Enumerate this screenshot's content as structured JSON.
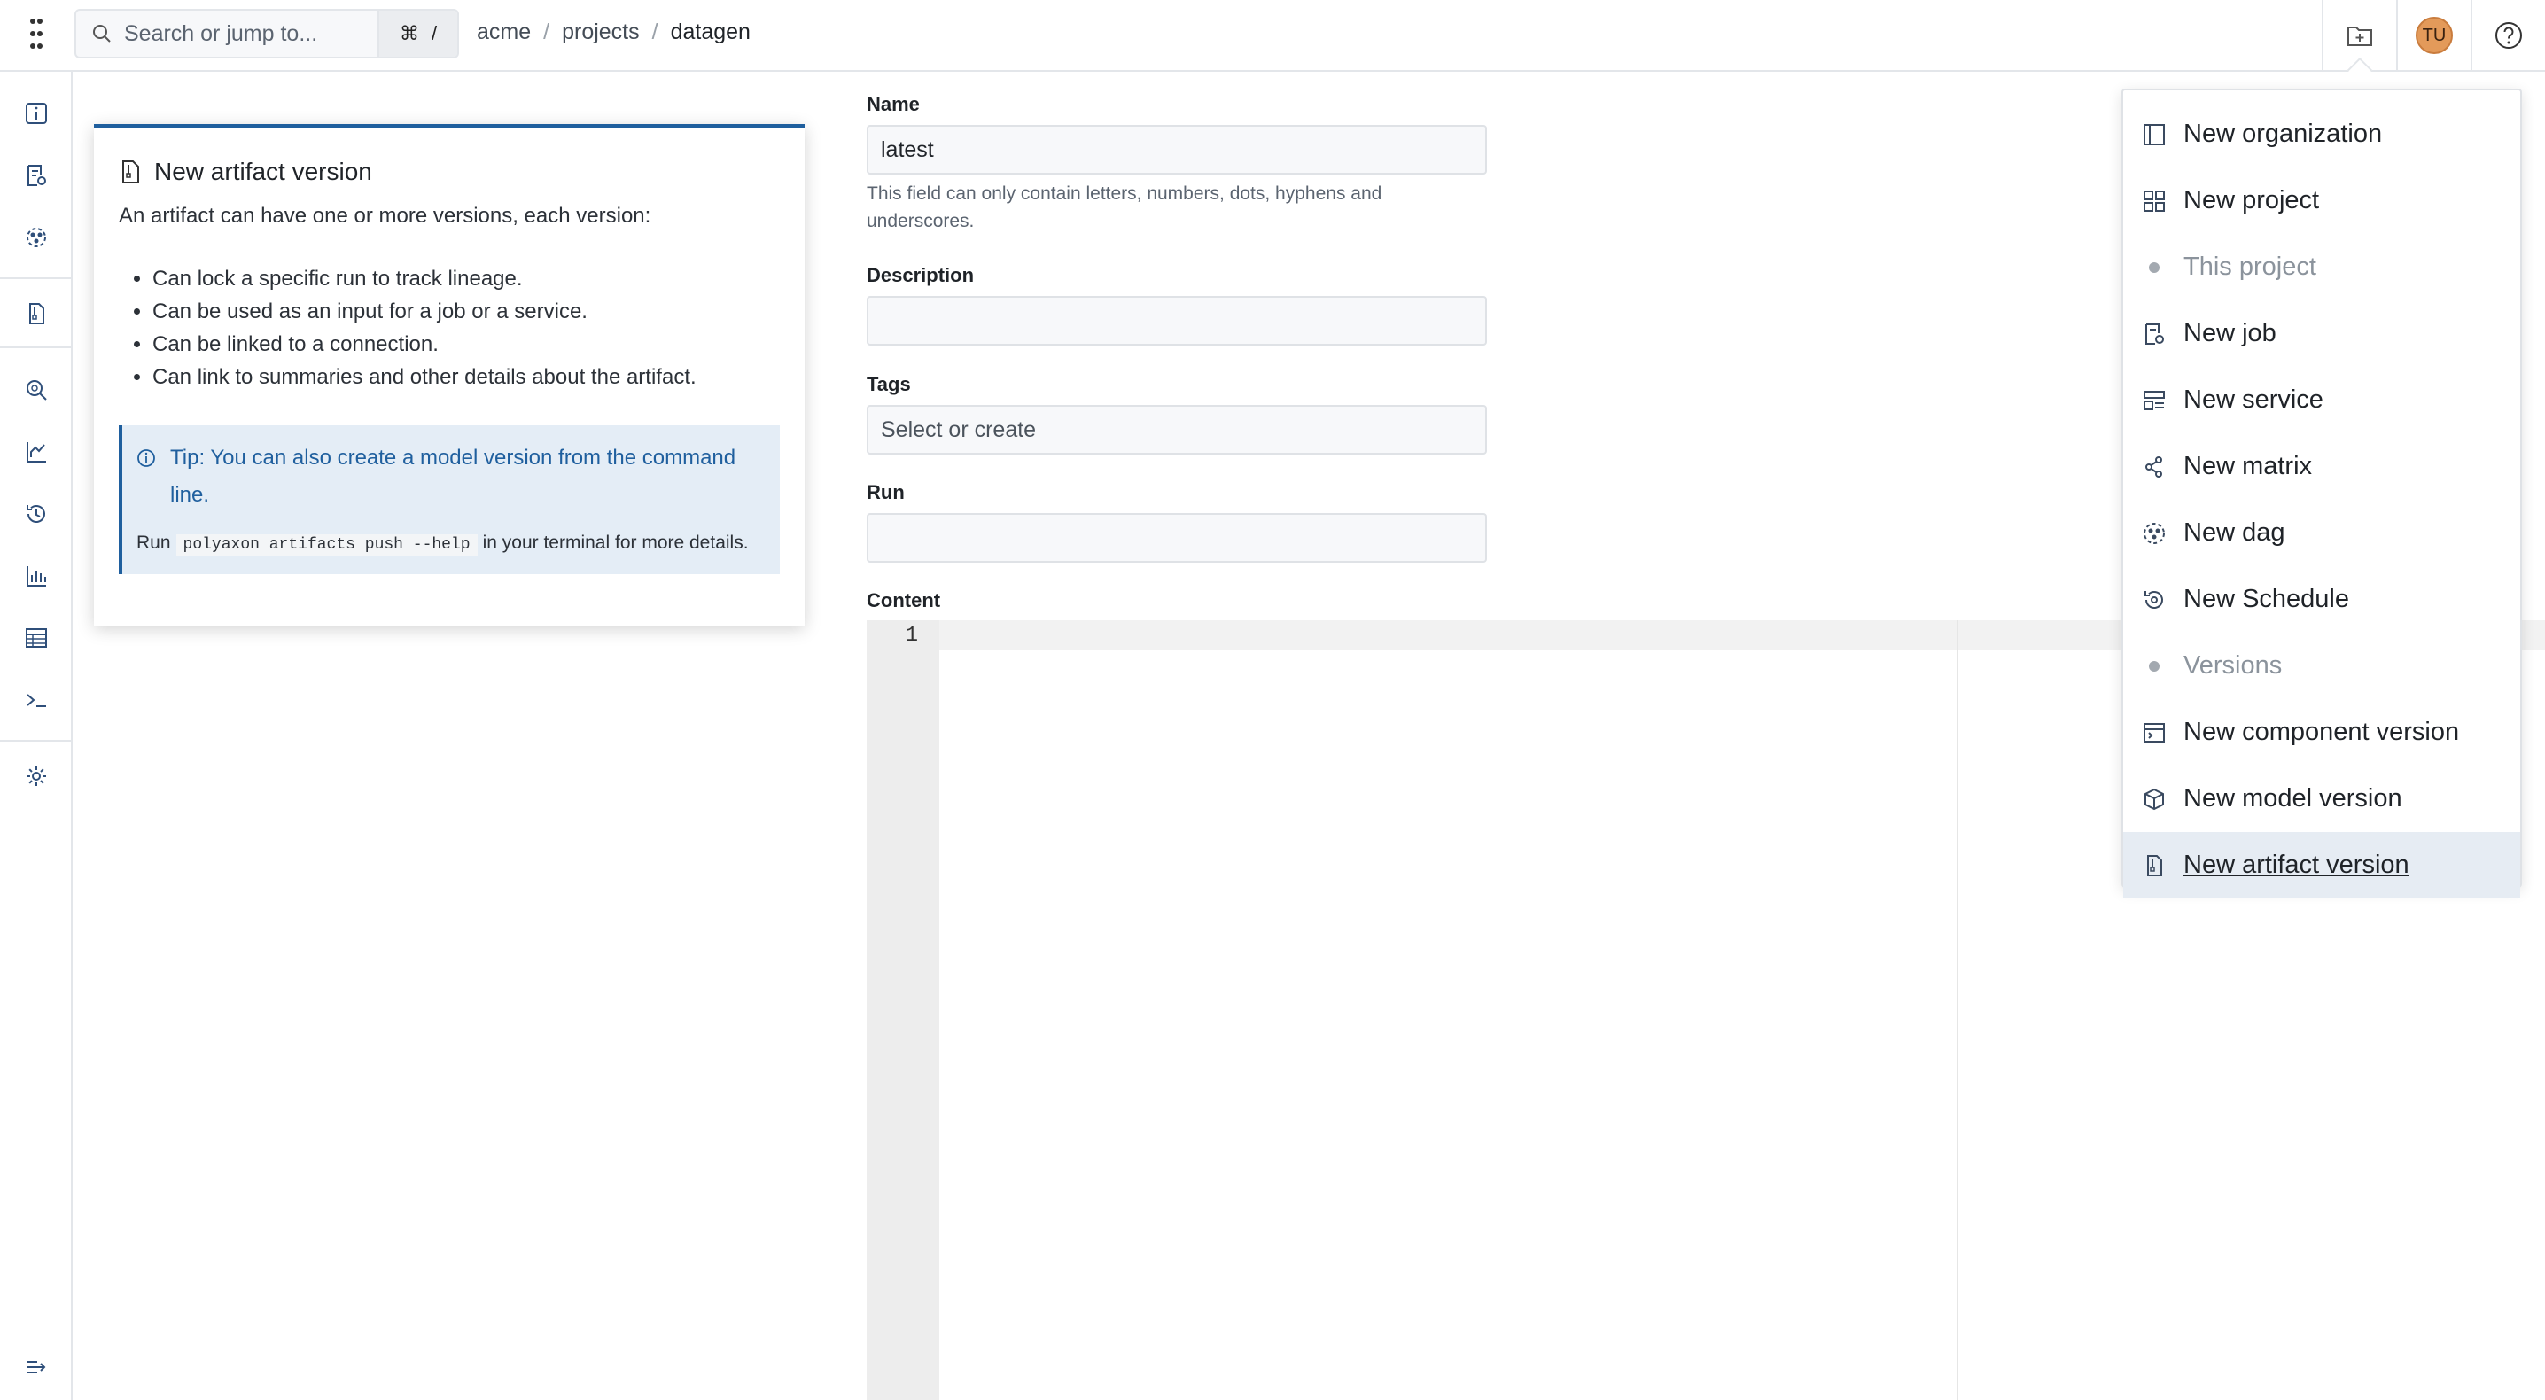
{
  "topbar": {
    "search_placeholder": "Search or jump to...",
    "shortcut_cmd": "⌘",
    "shortcut_slash": "/",
    "breadcrumbs": [
      "acme",
      "projects",
      "datagen"
    ],
    "breadcrumb_sep": "/",
    "avatar_initials": "TU"
  },
  "help": {
    "title": "New artifact version",
    "intro": "An artifact can have one or more versions, each version:",
    "bullets": [
      "Can lock a specific run to track lineage.",
      "Can be used as an input for a job or a service.",
      "Can be linked to a connection.",
      "Can link to summaries and other details about the artifact."
    ],
    "tip": "Tip: You can also create a model version from the command line.",
    "run_prefix": "Run",
    "run_command": "polyaxon artifacts push --help",
    "run_suffix": "in your terminal for more details."
  },
  "form": {
    "name_label": "Name",
    "name_value": "latest",
    "name_hint": "This field can only contain letters, numbers, dots, hyphens and underscores.",
    "description_label": "Description",
    "description_value": "",
    "tags_label": "Tags",
    "tags_placeholder": "Select or create",
    "run_label": "Run",
    "run_value": "",
    "content_label": "Content",
    "editor_line": "1"
  },
  "menu": {
    "items": [
      {
        "label": "New organization",
        "icon": "organization-icon",
        "type": "item"
      },
      {
        "label": "New project",
        "icon": "project-icon",
        "type": "item"
      },
      {
        "label": "This project",
        "icon": "dot",
        "type": "header"
      },
      {
        "label": "New job",
        "icon": "job-icon",
        "type": "item"
      },
      {
        "label": "New service",
        "icon": "service-icon",
        "type": "item"
      },
      {
        "label": "New matrix",
        "icon": "matrix-icon",
        "type": "item"
      },
      {
        "label": "New dag",
        "icon": "dag-icon",
        "type": "item"
      },
      {
        "label": "New Schedule",
        "icon": "schedule-icon",
        "type": "item"
      },
      {
        "label": "Versions",
        "icon": "dot",
        "type": "header"
      },
      {
        "label": "New component version",
        "icon": "component-icon",
        "type": "item"
      },
      {
        "label": "New model version",
        "icon": "model-icon",
        "type": "item"
      },
      {
        "label": "New artifact version",
        "icon": "artifact-icon",
        "type": "selected"
      }
    ]
  },
  "colors": {
    "accent": "#1f5f9e",
    "tip_bg": "#e4edf6",
    "avatar": "#e39a5a"
  }
}
